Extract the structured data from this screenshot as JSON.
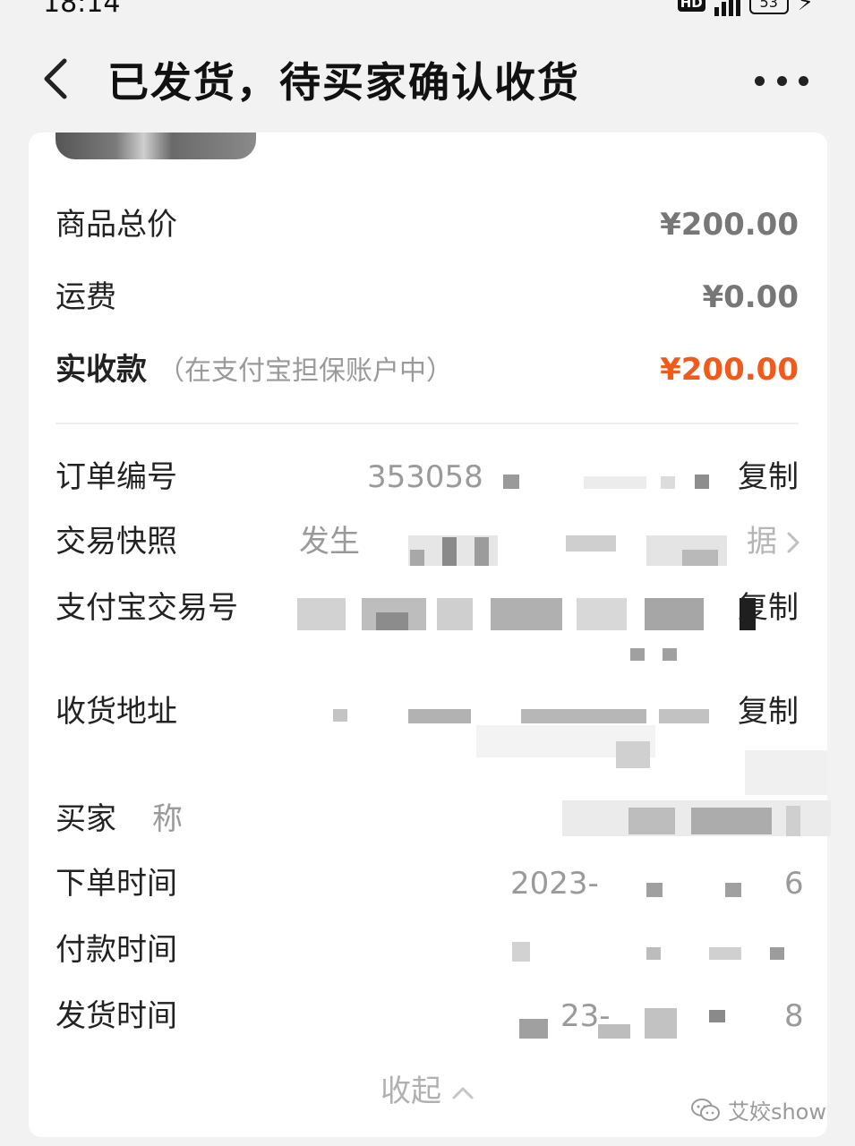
{
  "status_bar": {
    "time": "18:14",
    "hd_badge": "HD",
    "battery": "53"
  },
  "nav": {
    "title": "已发货，待买家确认收货"
  },
  "summary": {
    "goods_total_label": "商品总价",
    "goods_total_value": "¥200.00",
    "shipping_label": "运费",
    "shipping_value": "¥0.00",
    "received_label": "实收款",
    "received_note": "（在支付宝担保账户中）",
    "received_value": "¥200.00"
  },
  "details": {
    "order_no_label": "订单编号",
    "order_no_value": "353058",
    "copy_label": "复制",
    "snapshot_label": "交易快照",
    "snapshot_value": "发生",
    "snapshot_tail": "据",
    "alipay_label": "支付宝交易号",
    "address_label": "收货地址",
    "buyer_label": "买家",
    "buyer_label_tail": "称",
    "order_time_label": "下单时间",
    "order_time_value": "2023-",
    "order_time_tail": "6",
    "pay_time_label": "付款时间",
    "ship_time_label": "发货时间",
    "ship_time_value": "23-",
    "ship_time_tail": "8"
  },
  "collapse_label": "收起",
  "watermark": "艾姣show",
  "colors": {
    "accent_price": "#f05a1a",
    "background": "#f2f2f2",
    "card": "#ffffff"
  },
  "icons": {
    "back": "chevron-left-icon",
    "more": "more-dots-icon",
    "snapshot_arrow": "chevron-right-icon",
    "collapse": "chevron-up-icon",
    "watermark": "wechat-icon"
  }
}
